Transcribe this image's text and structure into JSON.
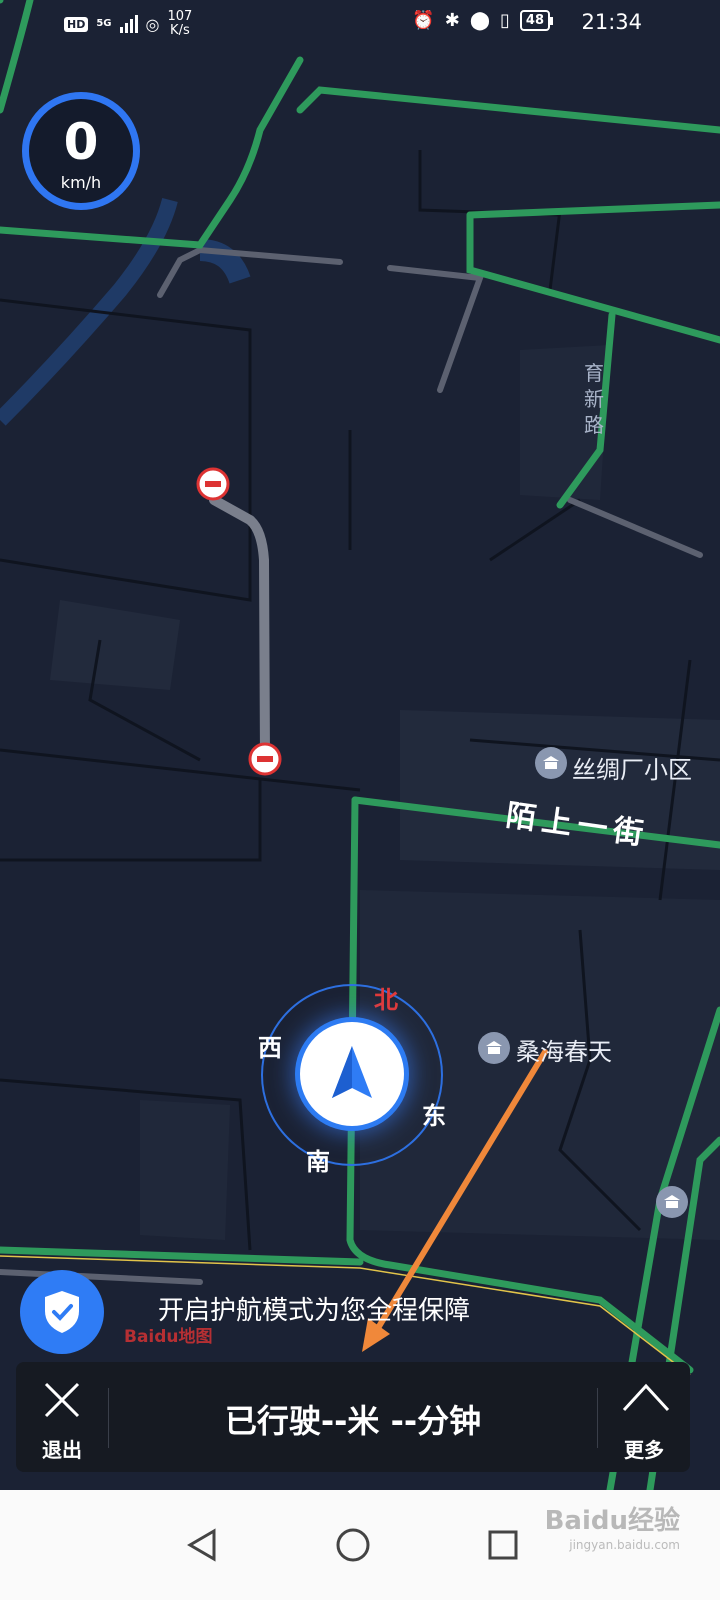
{
  "status_bar": {
    "hd": "HD",
    "network": "5G",
    "net_speed_value": "107",
    "net_speed_unit": "K/s",
    "battery": "48",
    "time": "21:34",
    "icons": [
      "alarm-icon",
      "bluetooth-icon",
      "location-icon",
      "vibrate-icon"
    ]
  },
  "speedometer": {
    "value": "0",
    "unit": "km/h"
  },
  "map": {
    "road_vertical": "育新路",
    "street_label": "陌上一街",
    "pois": [
      "丝绸厂小区",
      "桑海春天"
    ],
    "compass": {
      "north": "北",
      "west": "西",
      "east": "东",
      "south": "南"
    }
  },
  "guardian": {
    "text": "开启护航模式为您全程保障"
  },
  "logo": "Baidu地图",
  "bottom_bar": {
    "exit_label": "退出",
    "trip_info": "已行驶--米 --分钟",
    "more_label": "更多"
  },
  "watermark": {
    "main": "Baidu经验",
    "sub": "jingyan.baidu.com"
  },
  "colors": {
    "map_bg": "#1b2234",
    "road_green": "#2e9a5c",
    "accent_blue": "#2f7cf5",
    "arrow_orange": "#f0883a"
  }
}
